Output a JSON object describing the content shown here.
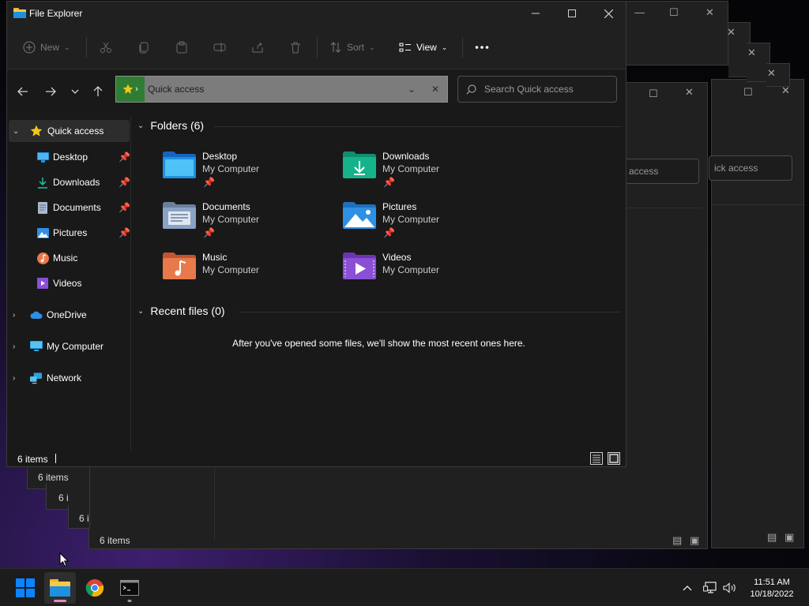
{
  "window": {
    "title": "File Explorer",
    "controls": {
      "minimize": "minimize-icon",
      "maximize": "maximize-icon",
      "close": "close-icon"
    }
  },
  "toolbar": {
    "new_label": "New",
    "sort_label": "Sort",
    "view_label": "View"
  },
  "address": {
    "location": "Quick access"
  },
  "search": {
    "placeholder": "Search Quick access"
  },
  "sidebar": {
    "items": [
      {
        "label": "Quick access",
        "icon": "star-icon"
      },
      {
        "label": "Desktop",
        "icon": "desktop-icon",
        "pinned": true
      },
      {
        "label": "Downloads",
        "icon": "download-icon",
        "pinned": true
      },
      {
        "label": "Documents",
        "icon": "document-icon",
        "pinned": true
      },
      {
        "label": "Pictures",
        "icon": "picture-icon",
        "pinned": true
      },
      {
        "label": "Music",
        "icon": "music-icon"
      },
      {
        "label": "Videos",
        "icon": "video-icon"
      },
      {
        "label": "OneDrive",
        "icon": "cloud-icon"
      },
      {
        "label": "My Computer",
        "icon": "computer-icon"
      },
      {
        "label": "Network",
        "icon": "network-icon"
      }
    ]
  },
  "folders": {
    "title": "Folders (6)",
    "items": [
      {
        "name": "Desktop",
        "location": "My Computer",
        "pinned": true,
        "color": "#1e90e0"
      },
      {
        "name": "Downloads",
        "location": "My Computer",
        "pinned": true,
        "color": "#16b38a"
      },
      {
        "name": "Documents",
        "location": "My Computer",
        "pinned": true,
        "color": "#8aa3c4"
      },
      {
        "name": "Pictures",
        "location": "My Computer",
        "pinned": true,
        "color": "#2f8fe3"
      },
      {
        "name": "Music",
        "location": "My Computer",
        "pinned": false,
        "color": "#e8794a"
      },
      {
        "name": "Videos",
        "location": "My Computer",
        "pinned": false,
        "color": "#8b4fd6"
      }
    ]
  },
  "recent": {
    "title": "Recent files (0)",
    "empty_message": "After you've opened some files, we'll show the most recent ones here."
  },
  "status": {
    "items_text": "6 items"
  },
  "background_windows": {
    "status_text_a": "6 items",
    "status_text_b": "6 i",
    "status_text_c": "6 i",
    "status_text_d": "6 items",
    "search_text_a": "access",
    "search_text_b": "ick access"
  },
  "taskbar": {
    "time": "11:51 AM",
    "date": "10/18/2022",
    "accent": "#0a84ff",
    "active_indicator": "#e58bb8"
  }
}
